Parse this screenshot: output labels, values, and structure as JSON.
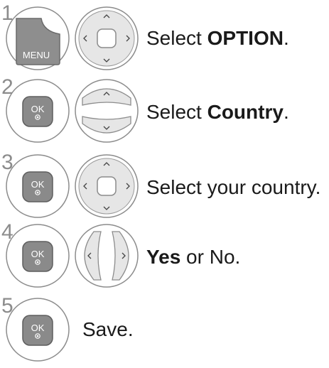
{
  "steps": [
    {
      "number": "1",
      "left_button": "MENU",
      "right_control": "4-way",
      "text_prefix": "Select ",
      "text_bold": "OPTION",
      "text_suffix": "."
    },
    {
      "number": "2",
      "left_button": "OK",
      "right_control": "up-down",
      "text_prefix": "Select ",
      "text_bold": "Country",
      "text_suffix": "."
    },
    {
      "number": "3",
      "left_button": "OK",
      "right_control": "4-way",
      "text_prefix": "Select your country.",
      "text_bold": "",
      "text_suffix": ""
    },
    {
      "number": "4",
      "left_button": "OK",
      "right_control": "left-right",
      "text_prefix": "",
      "text_bold": "Yes",
      "text_suffix": " or No."
    },
    {
      "number": "5",
      "left_button": "OK",
      "right_control": "",
      "text_prefix": "Save.",
      "text_bold": "",
      "text_suffix": ""
    }
  ],
  "icons": {
    "menu_button": "menu-button-icon",
    "ok_button": "ok-button-icon",
    "navigation_pad": "navigation-pad-icon",
    "up_down_keys": "up-down-keys-icon",
    "left_right_keys": "left-right-keys-icon"
  },
  "colors": {
    "button_fill": "#8a8a8a",
    "ring": "#8c8c8c",
    "pad_fill": "#e6e6e6"
  }
}
